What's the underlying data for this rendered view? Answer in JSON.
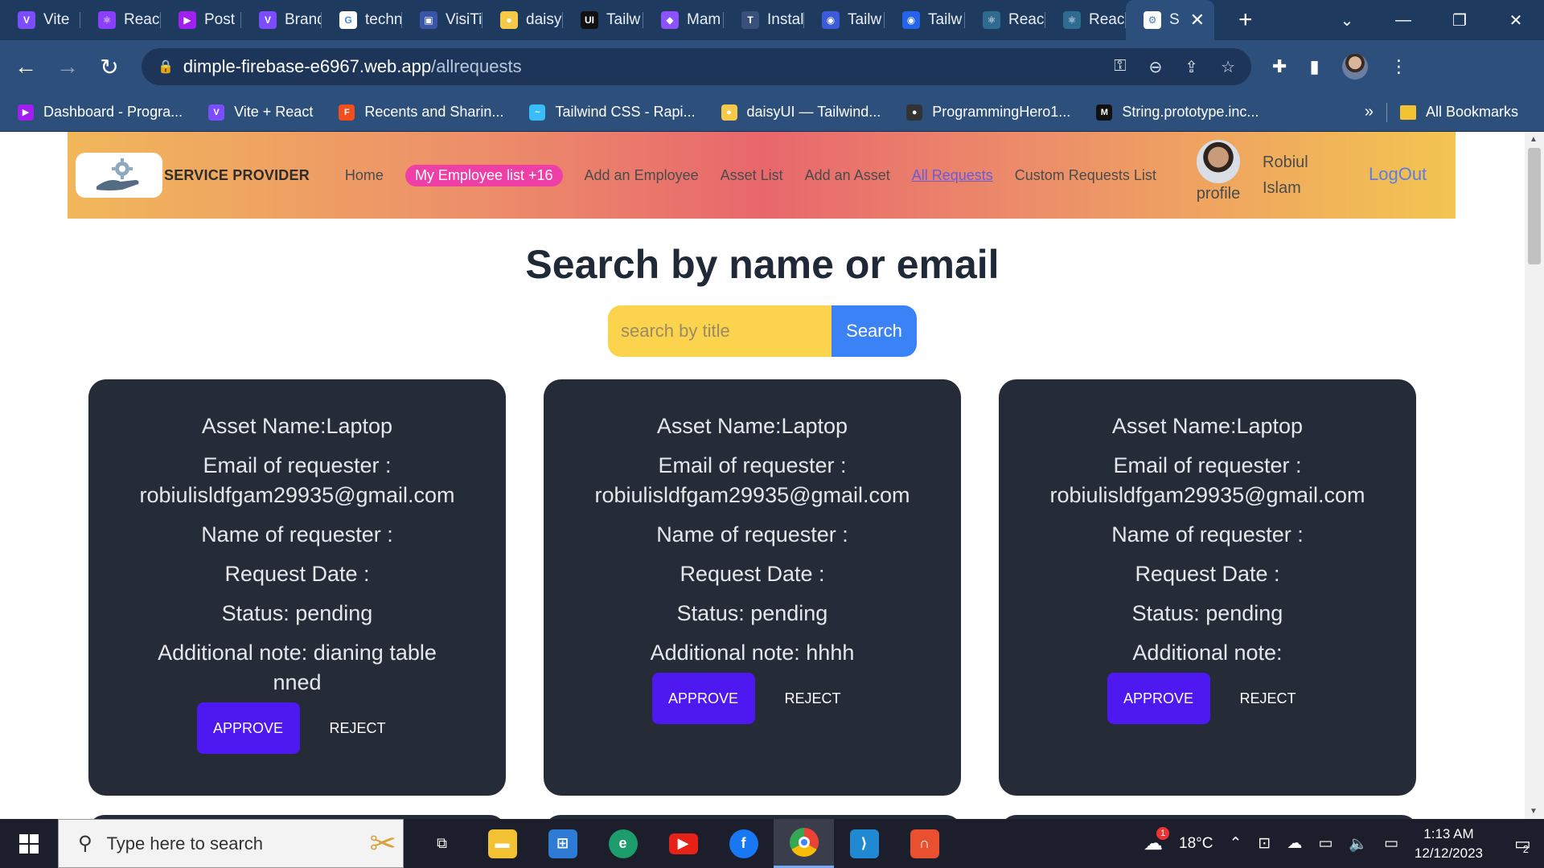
{
  "browser": {
    "tabs": [
      {
        "title": "Vite",
        "color": "#7c4dff",
        "icon": "vite-icon"
      },
      {
        "title": "React",
        "color": "#8a3ffc",
        "icon": "react-icon"
      },
      {
        "title": "Post",
        "color": "#a020f0",
        "icon": "post-icon"
      },
      {
        "title": "Brand",
        "color": "#7c4dff",
        "icon": "vite-icon"
      },
      {
        "title": "techn",
        "color": "#4285f4",
        "icon": "google-icon"
      },
      {
        "title": "VisiTi",
        "color": "#3955a8",
        "icon": "visitor-icon"
      },
      {
        "title": "daisy",
        "color": "#f7c948",
        "icon": "daisy-icon"
      },
      {
        "title": "Tailw",
        "color": "#111111",
        "icon": "ui-icon"
      },
      {
        "title": "Mam",
        "color": "#8c52ff",
        "icon": "mamba-icon"
      },
      {
        "title": "Instal",
        "color": "#3a4f7a",
        "icon": "install-icon"
      },
      {
        "title": "Tailw",
        "color": "#3b5bdb",
        "icon": "tailwind-icon"
      },
      {
        "title": "Tailw",
        "color": "#2563eb",
        "icon": "tailwind-icon"
      },
      {
        "title": "Reac",
        "color": "#2f6b8f",
        "icon": "react-icon"
      },
      {
        "title": "Reac",
        "color": "#2f6b8f",
        "icon": "react-icon"
      },
      {
        "title": "S",
        "color": "#4a79c4",
        "icon": "service-icon",
        "active": true
      }
    ],
    "url_domain": "dimple-firebase-e6967.web.app",
    "url_path": "/allrequests",
    "bookmarks": [
      {
        "label": "Dashboard - Progra...",
        "color": "#a020f0"
      },
      {
        "label": "Vite + React",
        "color": "#7c4dff"
      },
      {
        "label": "Recents and Sharin...",
        "color": "#f24e1e"
      },
      {
        "label": "Tailwind CSS - Rapi...",
        "color": "#38bdf8"
      },
      {
        "label": "daisyUI — Tailwind...",
        "color": "#f7c948"
      },
      {
        "label": "ProgrammingHero1...",
        "color": "#333333"
      },
      {
        "label": "String.prototype.inc...",
        "color": "#111111"
      }
    ],
    "bookmarks_more": "»",
    "all_bookmarks": "All Bookmarks"
  },
  "navbar": {
    "brand": "SERVICE PROVIDER",
    "links": [
      "Home",
      "My Employee list +16",
      "Add an Employee",
      "Asset List",
      "Add an Asset",
      "All Requests",
      "Custom Requests List"
    ],
    "profile_label": "profile",
    "username": "Robiul Islam",
    "logout": "LogOut"
  },
  "page": {
    "title": "Search by name or email",
    "search_placeholder": "search by title",
    "search_button": "Search"
  },
  "requests": [
    {
      "asset": "Asset Name:Laptop",
      "email_label": "Email of requester :",
      "email": "robiulisldfgam29935@gmail.com",
      "name": "Name of requester :",
      "date": "Request Date :",
      "status": "Status: pending",
      "note": "Additional note: dianing table nned",
      "approve": "APPROVE",
      "reject": "REJECT"
    },
    {
      "asset": "Asset Name:Laptop",
      "email_label": "Email of requester :",
      "email": "robiulisldfgam29935@gmail.com",
      "name": "Name of requester :",
      "date": "Request Date :",
      "status": "Status: pending",
      "note": "Additional note: hhhh",
      "approve": "APPROVE",
      "reject": "REJECT"
    },
    {
      "asset": "Asset Name:Laptop",
      "email_label": "Email of requester :",
      "email": "robiulisldfgam29935@gmail.com",
      "name": "Name of requester :",
      "date": "Request Date :",
      "status": "Status: pending",
      "note": "Additional note:",
      "approve": "APPROVE",
      "reject": "REJECT"
    }
  ],
  "taskbar": {
    "search_placeholder": "Type here to search",
    "weather": "18°C",
    "time": "1:13 AM",
    "date": "12/12/2023",
    "notification_count": "2",
    "weather_badge": "1"
  },
  "colors": {
    "accent": "#4e18f0",
    "card_bg": "#252b37",
    "search_bg": "#fcd34d",
    "search_button": "#3b82f6",
    "badge": "#ee3fa6"
  }
}
